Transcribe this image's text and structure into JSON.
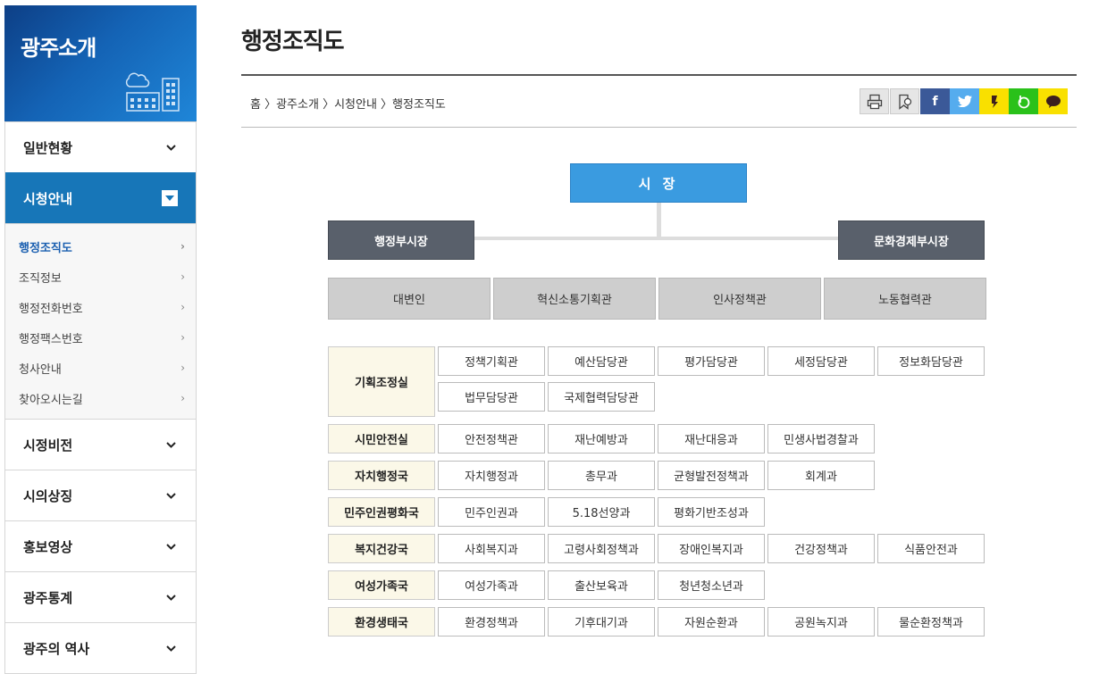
{
  "sidebar": {
    "title": "광주소개",
    "menu_top": [
      {
        "label": "일반현황"
      }
    ],
    "active": {
      "label": "시청안내"
    },
    "submenu": [
      {
        "label": "행정조직도",
        "active": true
      },
      {
        "label": "조직정보"
      },
      {
        "label": "행정전화번호"
      },
      {
        "label": "행정팩스번호"
      },
      {
        "label": "청사안내"
      },
      {
        "label": "찾아오시는길"
      }
    ],
    "menu_bottom": [
      {
        "label": "시정비전"
      },
      {
        "label": "시의상징"
      },
      {
        "label": "홍보영상"
      },
      {
        "label": "광주통계"
      },
      {
        "label": "광주의 역사"
      }
    ]
  },
  "page": {
    "title": "행정조직도",
    "breadcrumb": "홈 〉광주소개 〉시청안내 〉행정조직도"
  },
  "share_icons": [
    "print-icon",
    "bookmark-icon",
    "facebook-icon",
    "twitter-icon",
    "kakaostory-icon",
    "band-icon",
    "kakaotalk-icon"
  ],
  "colors": {
    "brand_blue": "#1776b8",
    "mayor_blue": "#3a9be0",
    "deputy_gray": "#59606b",
    "staff_gray": "#cecece",
    "dept_bg": "#fbf8e8",
    "facebook": "#3b5998",
    "twitter": "#55acee",
    "kakao": "#f9e000",
    "band": "#2ac11a"
  },
  "org": {
    "mayor": "시 장",
    "deputies": [
      "행정부시장",
      "문화경제부시장"
    ],
    "staff": [
      "대변인",
      "혁신소통기획관",
      "인사정책관",
      "노동협력관"
    ],
    "departments": [
      {
        "name": "기획조정실",
        "divisions": [
          "정책기획관",
          "예산담당관",
          "평가담당관",
          "세정담당관",
          "정보화담당관",
          "법무담당관",
          "국제협력담당관"
        ]
      },
      {
        "name": "시민안전실",
        "divisions": [
          "안전정책관",
          "재난예방과",
          "재난대응과",
          "민생사법경찰과"
        ]
      },
      {
        "name": "자치행정국",
        "divisions": [
          "자치행정과",
          "총무과",
          "균형발전정책과",
          "회계과"
        ]
      },
      {
        "name": "민주인권평화국",
        "divisions": [
          "민주인권과",
          "5.18선양과",
          "평화기반조성과"
        ]
      },
      {
        "name": "복지건강국",
        "divisions": [
          "사회복지과",
          "고령사회정책과",
          "장애인복지과",
          "건강정책과",
          "식품안전과"
        ]
      },
      {
        "name": "여성가족국",
        "divisions": [
          "여성가족과",
          "출산보육과",
          "청년청소년과"
        ]
      },
      {
        "name": "환경생태국",
        "divisions": [
          "환경정책과",
          "기후대기과",
          "자원순환과",
          "공원녹지과",
          "물순환정책과"
        ]
      }
    ]
  }
}
